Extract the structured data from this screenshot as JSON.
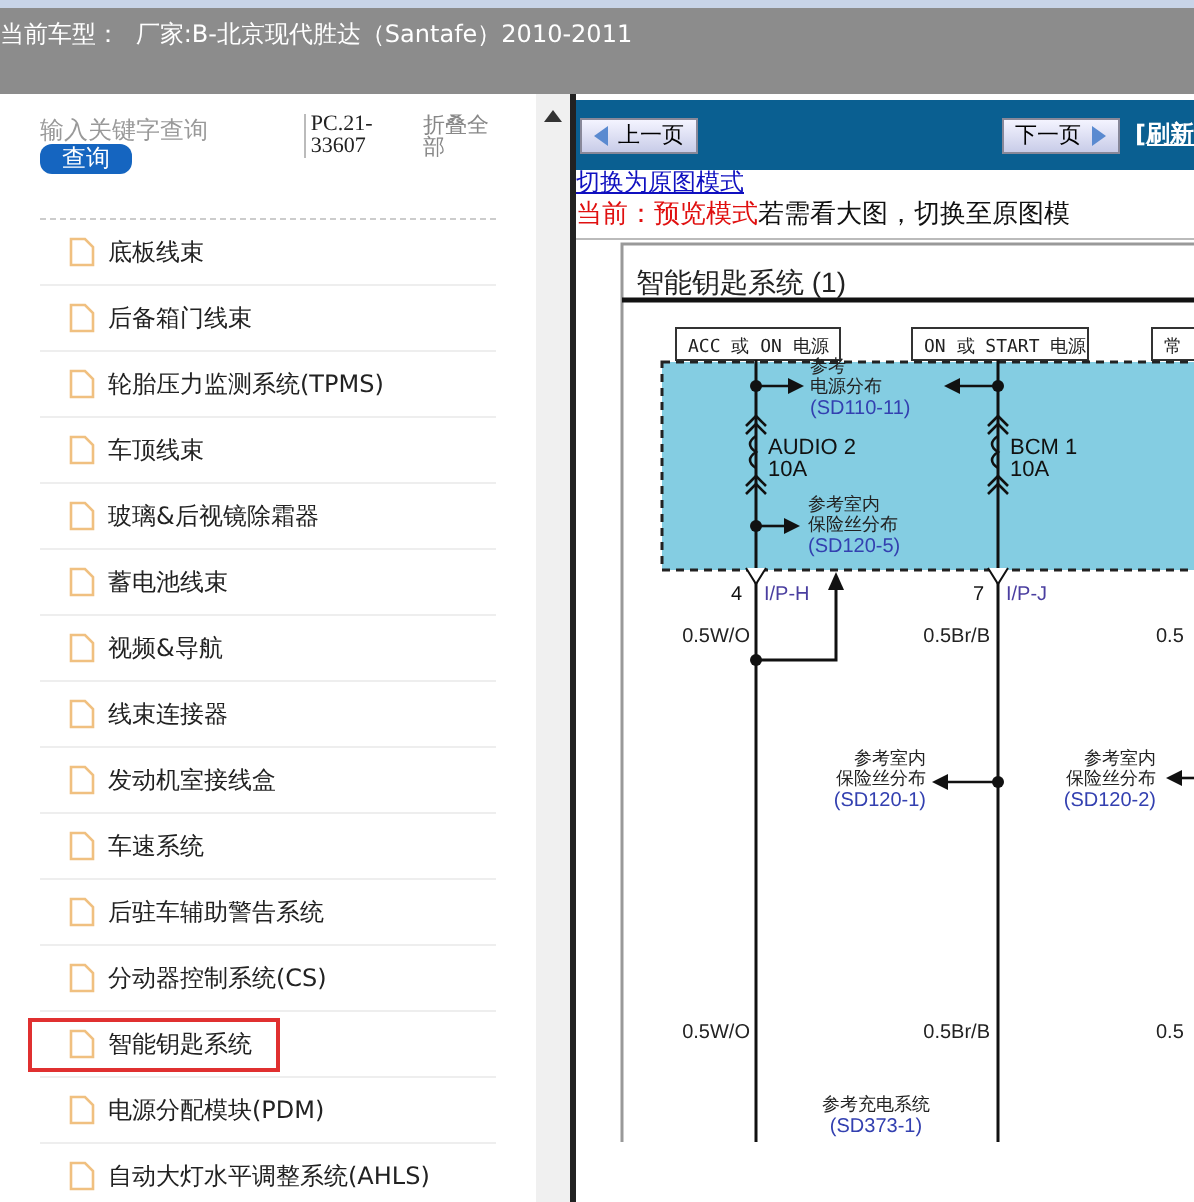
{
  "header": {
    "label": "当前车型：",
    "value": "厂家:B-北京现代胜达（Santafe）2010-2011"
  },
  "sidebar": {
    "search": {
      "placeholder": "输入关键字查询",
      "button": "查询"
    },
    "code": "PC.21-33607",
    "collapse": "折叠全部",
    "items": [
      {
        "label": "底板线束",
        "selected": false
      },
      {
        "label": "后备箱门线束",
        "selected": false
      },
      {
        "label": "轮胎压力监测系统(TPMS)",
        "selected": false
      },
      {
        "label": "车顶线束",
        "selected": false
      },
      {
        "label": "玻璃&后视镜除霜器",
        "selected": false
      },
      {
        "label": "蓄电池线束",
        "selected": false
      },
      {
        "label": "视频&导航",
        "selected": false
      },
      {
        "label": "线束连接器",
        "selected": false
      },
      {
        "label": "发动机室接线盒",
        "selected": false
      },
      {
        "label": "车速系统",
        "selected": false
      },
      {
        "label": "后驻车辅助警告系统",
        "selected": false
      },
      {
        "label": "分动器控制系统(CS)",
        "selected": false
      },
      {
        "label": "智能钥匙系统",
        "selected": true
      },
      {
        "label": "电源分配模块(PDM)",
        "selected": false
      },
      {
        "label": "自动大灯水平调整系统(AHLS)",
        "selected": false
      }
    ]
  },
  "viewer": {
    "prev": "上一页",
    "next": "下一页",
    "refresh": "[刷新",
    "mode_link": "切换为原图模式",
    "mode_label": "当前：预览模式",
    "mode_hint": "若需看大图，切换至原图模",
    "diagram": {
      "title": "智能钥匙系统 (1)",
      "sources": [
        "ACC 或 ON 电源",
        "ON 或 START 电源",
        "常"
      ],
      "fuses": [
        {
          "name": "AUDIO 2",
          "rating": "10A"
        },
        {
          "name": "BCM 1",
          "rating": "10A"
        }
      ],
      "pins": [
        {
          "number": "4",
          "name": "I/P-H"
        },
        {
          "number": "7",
          "name": "I/P-J"
        }
      ],
      "wire_labels_upper": [
        "0.5W/O",
        "0.5Br/B",
        "0.5"
      ],
      "wire_labels_lower": [
        "0.5W/O",
        "0.5Br/B",
        "0.5"
      ],
      "references": [
        {
          "lines": [
            "参考",
            "电源分布"
          ],
          "code": "(SD110-11)"
        },
        {
          "lines": [
            "参考室内",
            "保险丝分布"
          ],
          "code": "(SD120-5)"
        },
        {
          "lines": [
            "参考室内",
            "保险丝分布"
          ],
          "code": "(SD120-1)"
        },
        {
          "lines": [
            "参考室内",
            "保险丝分布"
          ],
          "code": "(SD120-2)"
        },
        {
          "lines": [
            "参考充电系统"
          ],
          "code": "(SD373-1)"
        }
      ]
    }
  }
}
